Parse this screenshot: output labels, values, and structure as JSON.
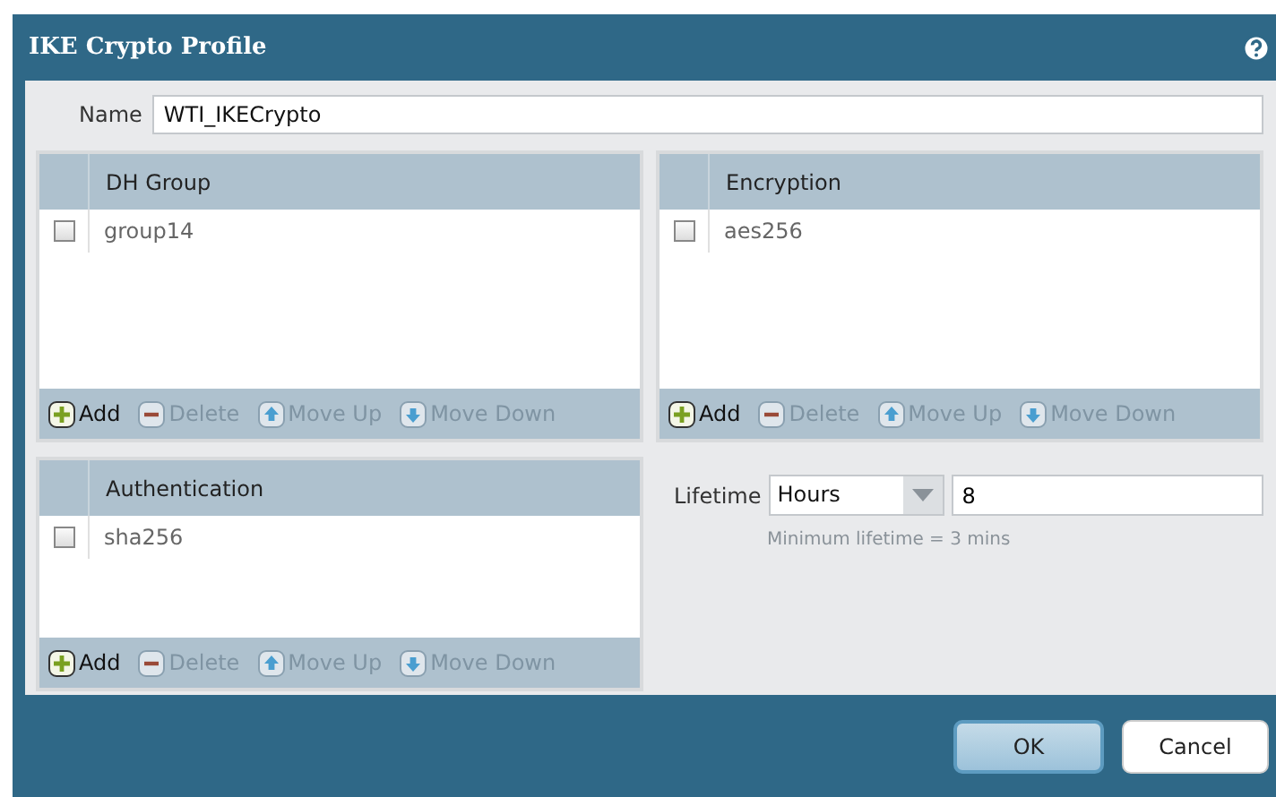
{
  "window": {
    "title": "IKE Crypto Profile"
  },
  "name_field": {
    "label": "Name",
    "value": "WTI_IKECrypto"
  },
  "grids": [
    {
      "column": "DH Group",
      "rows": [
        {
          "value": "group14",
          "checked": false
        }
      ],
      "toolbar": [
        {
          "kind": "add",
          "label": "Add",
          "disabled": false
        },
        {
          "kind": "delete",
          "label": "Delete",
          "disabled": true
        },
        {
          "kind": "up",
          "label": "Move Up",
          "disabled": true
        },
        {
          "kind": "down",
          "label": "Move Down",
          "disabled": true
        }
      ]
    },
    {
      "column": "Encryption",
      "rows": [
        {
          "value": "aes256",
          "checked": false
        }
      ],
      "toolbar": [
        {
          "kind": "add",
          "label": "Add",
          "disabled": false
        },
        {
          "kind": "delete",
          "label": "Delete",
          "disabled": true
        },
        {
          "kind": "up",
          "label": "Move Up",
          "disabled": true
        },
        {
          "kind": "down",
          "label": "Move Down",
          "disabled": true
        }
      ]
    },
    {
      "column": "Authentication",
      "rows": [
        {
          "value": "sha256",
          "checked": false
        }
      ],
      "toolbar": [
        {
          "kind": "add",
          "label": "Add",
          "disabled": false
        },
        {
          "kind": "delete",
          "label": "Delete",
          "disabled": true
        },
        {
          "kind": "up",
          "label": "Move Up",
          "disabled": true
        },
        {
          "kind": "down",
          "label": "Move Down",
          "disabled": true
        }
      ]
    }
  ],
  "lifetime": {
    "label": "Lifetime",
    "unit": "Hours",
    "value": "8",
    "hint": "Minimum lifetime = 3 mins"
  },
  "buttons": [
    {
      "label": "OK",
      "primary": true
    },
    {
      "label": "Cancel",
      "primary": false
    }
  ]
}
